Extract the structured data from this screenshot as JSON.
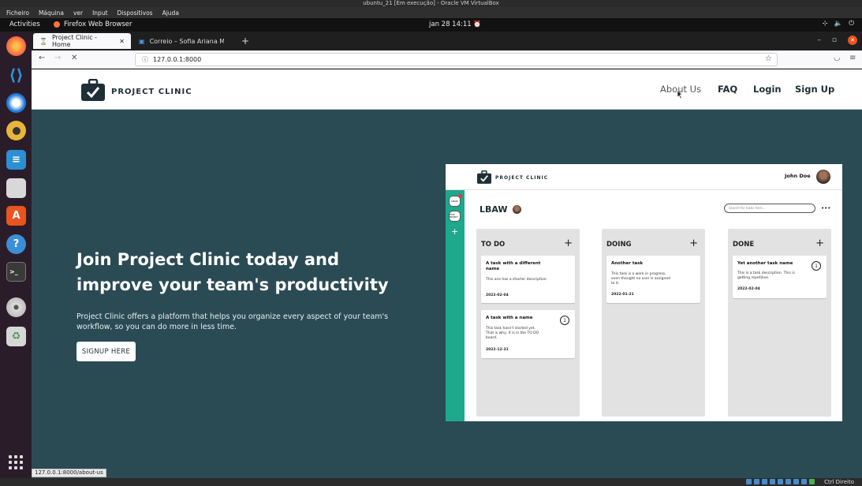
{
  "vbox": {
    "title": "ubuntu_21 [Em execução] - Oracle VM VirtualBox",
    "menu": [
      "Ficheiro",
      "Máquina",
      "ver",
      "Input",
      "Dispositivos",
      "Ajuda"
    ],
    "hostkey": "Ctrl Direito"
  },
  "topbar": {
    "activities": "Activities",
    "app": "Firefox Web Browser",
    "clock": "jan 28  14:11"
  },
  "browser": {
    "tabs": [
      {
        "label": "Project Clinic - Home"
      },
      {
        "label": "Correio – Sofia Ariana Mo"
      }
    ],
    "url": "127.0.0.1:8000",
    "status_url": "127.0.0.1:8000/about-us"
  },
  "site": {
    "brand": "PROJECT CLINIC",
    "nav": {
      "about": "About Us",
      "faq": "FAQ",
      "login": "Login",
      "signup": "Sign Up"
    },
    "hero": {
      "heading": "Join Project Clinic today and improve your team's productivity",
      "paragraph": "Project Clinic offers a platform that helps you organize every aspect of your team's workflow, so you can do more in less time.",
      "button": "SIGNUP HERE"
    },
    "preview": {
      "brand": "PROJECT CLINIC",
      "user": "John Doe",
      "sidebar": [
        "LBAW",
        "FEUP PROJECT"
      ],
      "project": "LBAW",
      "search_placeholder": "Search for tasks here...",
      "more": "•••",
      "columns": [
        {
          "title": "TO DO",
          "cards": [
            {
              "title": "A task with a different name",
              "desc": "This one has a shorter description.",
              "date": "2022-02-04",
              "badge": ""
            },
            {
              "title": "A task with a name",
              "desc": "This task hasn't started yet. That is why, it is in the TO DO board.",
              "date": "2022-12-31",
              "badge": "1"
            }
          ]
        },
        {
          "title": "DOING",
          "cards": [
            {
              "title": "Another task",
              "desc": "This task is a work in progress, even thought no user is assigned to it.",
              "date": "2022-01-21",
              "badge": ""
            }
          ]
        },
        {
          "title": "DONE",
          "cards": [
            {
              "title": "Yet another task name",
              "desc": "This is a task description. This is getting repetitive.",
              "date": "2022-02-04",
              "badge": "1"
            }
          ]
        }
      ]
    }
  },
  "colors": {
    "hero_bg": "#2b4b54",
    "brand_dark": "#1e2f35",
    "sidebar_green": "#1ea88c",
    "ubuntu_orange": "#e95420"
  }
}
